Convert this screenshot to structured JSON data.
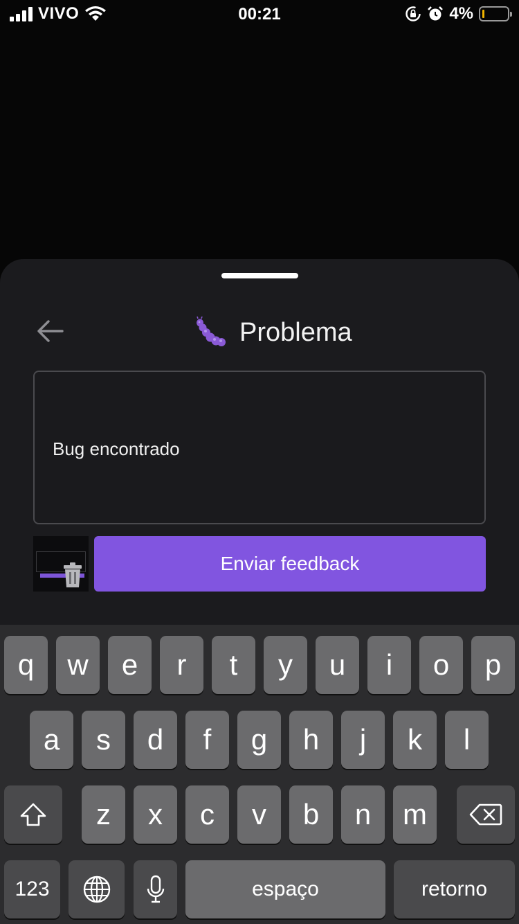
{
  "status_bar": {
    "carrier": "VIVO",
    "time": "00:21",
    "battery_percent": "4%",
    "battery_level": 0.04,
    "icons": [
      "signal-icon",
      "wifi-icon",
      "orientation-lock-icon",
      "alarm-icon",
      "battery-icon"
    ]
  },
  "sheet": {
    "title": "Problema",
    "title_icon": "bug-icon",
    "back_icon": "back-arrow-icon",
    "input_value": "Bug encontrado",
    "attachment_icon": "trash-icon",
    "send_label": "Enviar feedback"
  },
  "colors": {
    "accent": "#8155e0",
    "sheet_bg": "#1b1b1e",
    "keyboard_bg": "#2c2c2e",
    "key_bg": "#6b6b6d"
  },
  "keyboard": {
    "row1": [
      "q",
      "w",
      "e",
      "r",
      "t",
      "y",
      "u",
      "i",
      "o",
      "p"
    ],
    "row2": [
      "a",
      "s",
      "d",
      "f",
      "g",
      "h",
      "j",
      "k",
      "l"
    ],
    "row3": [
      "z",
      "x",
      "c",
      "v",
      "b",
      "n",
      "m"
    ],
    "numbers_label": "123",
    "space_label": "espaço",
    "return_label": "retorno",
    "shift_icon": "shift-icon",
    "delete_icon": "delete-icon",
    "globe_icon": "globe-icon",
    "mic_icon": "microphone-icon"
  }
}
